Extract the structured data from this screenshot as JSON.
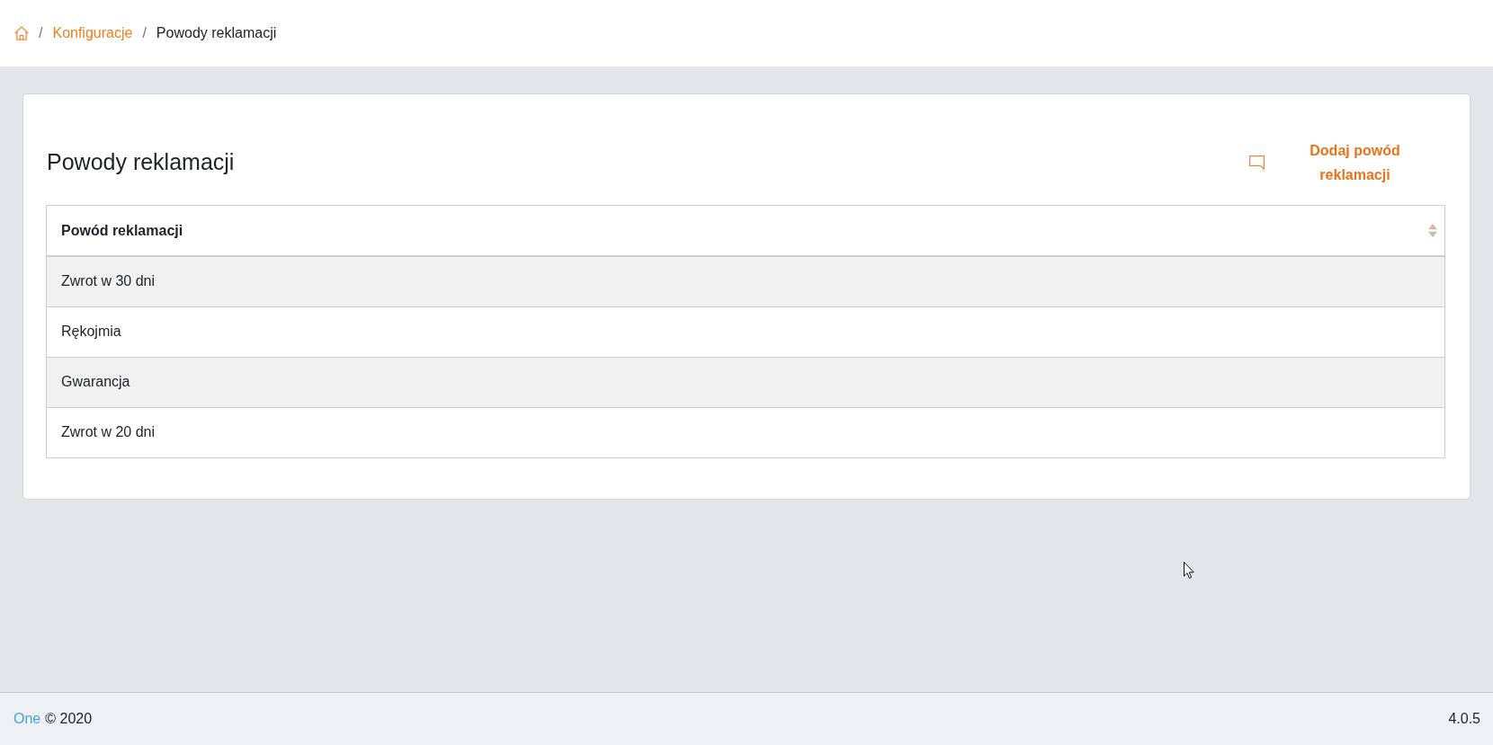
{
  "breadcrumb": [
    {
      "kind": "home"
    },
    {
      "kind": "link",
      "separator": "/",
      "label": "Konfiguracje"
    },
    {
      "kind": "current",
      "separator": "/",
      "label": "Powody reklamacji"
    }
  ],
  "card": {
    "title": "Powody reklamacji",
    "add_button": {
      "label": "Dodaj powód reklamacji"
    }
  },
  "table": {
    "columns": [
      {
        "label": "Powód reklamacji",
        "sortable": true
      }
    ],
    "rows": [
      {
        "cells": [
          "Zwrot w 30 dni"
        ]
      },
      {
        "cells": [
          "Rękojmia"
        ]
      },
      {
        "cells": [
          "Gwarancja"
        ]
      },
      {
        "cells": [
          "Zwrot w 20 dni"
        ]
      }
    ]
  },
  "footer": {
    "brand": "One",
    "copyright": "© 2020",
    "version": "4.0.5"
  }
}
